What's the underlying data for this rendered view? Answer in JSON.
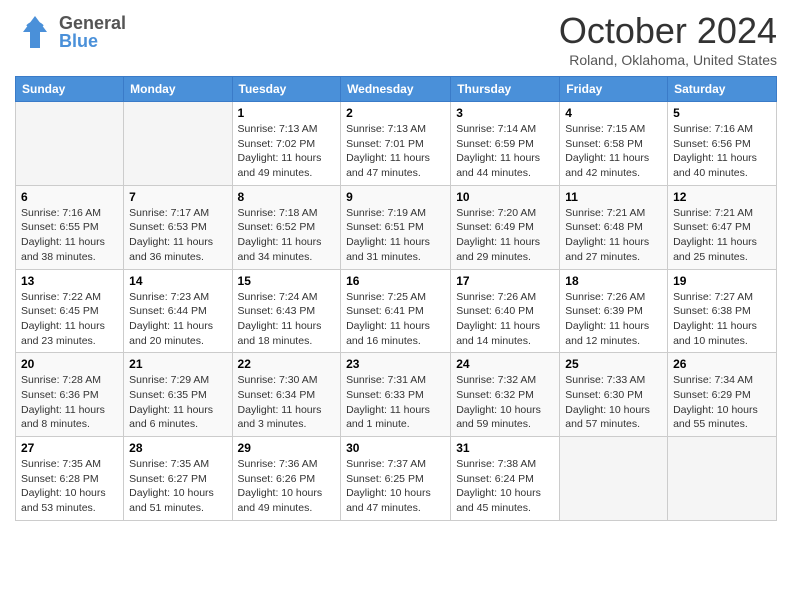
{
  "header": {
    "logo_general": "General",
    "logo_blue": "Blue",
    "month": "October 2024",
    "location": "Roland, Oklahoma, United States"
  },
  "days_of_week": [
    "Sunday",
    "Monday",
    "Tuesday",
    "Wednesday",
    "Thursday",
    "Friday",
    "Saturday"
  ],
  "weeks": [
    [
      {
        "day": "",
        "info": ""
      },
      {
        "day": "",
        "info": ""
      },
      {
        "day": "1",
        "info": "Sunrise: 7:13 AM\nSunset: 7:02 PM\nDaylight: 11 hours and 49 minutes."
      },
      {
        "day": "2",
        "info": "Sunrise: 7:13 AM\nSunset: 7:01 PM\nDaylight: 11 hours and 47 minutes."
      },
      {
        "day": "3",
        "info": "Sunrise: 7:14 AM\nSunset: 6:59 PM\nDaylight: 11 hours and 44 minutes."
      },
      {
        "day": "4",
        "info": "Sunrise: 7:15 AM\nSunset: 6:58 PM\nDaylight: 11 hours and 42 minutes."
      },
      {
        "day": "5",
        "info": "Sunrise: 7:16 AM\nSunset: 6:56 PM\nDaylight: 11 hours and 40 minutes."
      }
    ],
    [
      {
        "day": "6",
        "info": "Sunrise: 7:16 AM\nSunset: 6:55 PM\nDaylight: 11 hours and 38 minutes."
      },
      {
        "day": "7",
        "info": "Sunrise: 7:17 AM\nSunset: 6:53 PM\nDaylight: 11 hours and 36 minutes."
      },
      {
        "day": "8",
        "info": "Sunrise: 7:18 AM\nSunset: 6:52 PM\nDaylight: 11 hours and 34 minutes."
      },
      {
        "day": "9",
        "info": "Sunrise: 7:19 AM\nSunset: 6:51 PM\nDaylight: 11 hours and 31 minutes."
      },
      {
        "day": "10",
        "info": "Sunrise: 7:20 AM\nSunset: 6:49 PM\nDaylight: 11 hours and 29 minutes."
      },
      {
        "day": "11",
        "info": "Sunrise: 7:21 AM\nSunset: 6:48 PM\nDaylight: 11 hours and 27 minutes."
      },
      {
        "day": "12",
        "info": "Sunrise: 7:21 AM\nSunset: 6:47 PM\nDaylight: 11 hours and 25 minutes."
      }
    ],
    [
      {
        "day": "13",
        "info": "Sunrise: 7:22 AM\nSunset: 6:45 PM\nDaylight: 11 hours and 23 minutes."
      },
      {
        "day": "14",
        "info": "Sunrise: 7:23 AM\nSunset: 6:44 PM\nDaylight: 11 hours and 20 minutes."
      },
      {
        "day": "15",
        "info": "Sunrise: 7:24 AM\nSunset: 6:43 PM\nDaylight: 11 hours and 18 minutes."
      },
      {
        "day": "16",
        "info": "Sunrise: 7:25 AM\nSunset: 6:41 PM\nDaylight: 11 hours and 16 minutes."
      },
      {
        "day": "17",
        "info": "Sunrise: 7:26 AM\nSunset: 6:40 PM\nDaylight: 11 hours and 14 minutes."
      },
      {
        "day": "18",
        "info": "Sunrise: 7:26 AM\nSunset: 6:39 PM\nDaylight: 11 hours and 12 minutes."
      },
      {
        "day": "19",
        "info": "Sunrise: 7:27 AM\nSunset: 6:38 PM\nDaylight: 11 hours and 10 minutes."
      }
    ],
    [
      {
        "day": "20",
        "info": "Sunrise: 7:28 AM\nSunset: 6:36 PM\nDaylight: 11 hours and 8 minutes."
      },
      {
        "day": "21",
        "info": "Sunrise: 7:29 AM\nSunset: 6:35 PM\nDaylight: 11 hours and 6 minutes."
      },
      {
        "day": "22",
        "info": "Sunrise: 7:30 AM\nSunset: 6:34 PM\nDaylight: 11 hours and 3 minutes."
      },
      {
        "day": "23",
        "info": "Sunrise: 7:31 AM\nSunset: 6:33 PM\nDaylight: 11 hours and 1 minute."
      },
      {
        "day": "24",
        "info": "Sunrise: 7:32 AM\nSunset: 6:32 PM\nDaylight: 10 hours and 59 minutes."
      },
      {
        "day": "25",
        "info": "Sunrise: 7:33 AM\nSunset: 6:30 PM\nDaylight: 10 hours and 57 minutes."
      },
      {
        "day": "26",
        "info": "Sunrise: 7:34 AM\nSunset: 6:29 PM\nDaylight: 10 hours and 55 minutes."
      }
    ],
    [
      {
        "day": "27",
        "info": "Sunrise: 7:35 AM\nSunset: 6:28 PM\nDaylight: 10 hours and 53 minutes."
      },
      {
        "day": "28",
        "info": "Sunrise: 7:35 AM\nSunset: 6:27 PM\nDaylight: 10 hours and 51 minutes."
      },
      {
        "day": "29",
        "info": "Sunrise: 7:36 AM\nSunset: 6:26 PM\nDaylight: 10 hours and 49 minutes."
      },
      {
        "day": "30",
        "info": "Sunrise: 7:37 AM\nSunset: 6:25 PM\nDaylight: 10 hours and 47 minutes."
      },
      {
        "day": "31",
        "info": "Sunrise: 7:38 AM\nSunset: 6:24 PM\nDaylight: 10 hours and 45 minutes."
      },
      {
        "day": "",
        "info": ""
      },
      {
        "day": "",
        "info": ""
      }
    ]
  ]
}
